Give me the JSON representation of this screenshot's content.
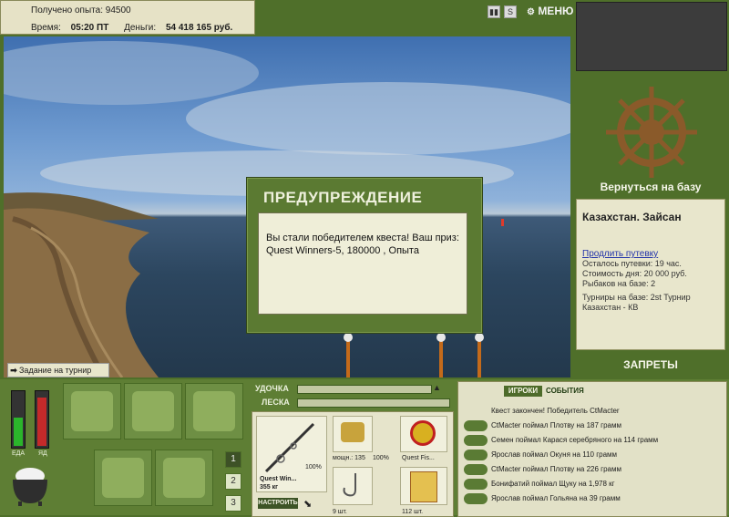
{
  "header": {
    "exp_label": "Получено опыта:",
    "exp_value": "94500",
    "time_label": "Время:",
    "time_value": "05:20 ПТ",
    "money_label": "Деньги:",
    "money_value": "54 418 165 руб.",
    "menu_label": "МЕНЮ"
  },
  "dialog": {
    "title": "ПРЕДУПРЕЖДЕНИЕ",
    "message": "Вы стали победителем квеста! Ваш приз: Quest Winners-5, 180000 , Опыта"
  },
  "quest_button": "Задание на турнир",
  "right_panel": {
    "return_base": "Вернуться на базу",
    "location": "Казахстан. Зайсан",
    "extend_link": "Продлить путевку",
    "info": [
      "Осталось путевки: 19 час.",
      "Стоимость дня: 20 000 руб.",
      "Рыбаков на базе: 2",
      "Турниры на базе: 2st Турнир Казахстан - КВ"
    ],
    "bans": "ЗАПРЕТЫ"
  },
  "meters": {
    "food_label": "ЕДА",
    "poison_label": "ЯД",
    "food_level": 0.55,
    "poison_level": 0.95
  },
  "inventory": {
    "pages": [
      "1",
      "2",
      "3"
    ]
  },
  "tackle": {
    "rod_label": "УДОЧКА",
    "line_label": "ЛЕСКА",
    "rod_name": "Quest Win...",
    "rod_weight": "355 кг",
    "rod_pct": "100%",
    "reel_caption": "мощн.: 135",
    "reel_pct": "100%",
    "line_name": "Quest Fis...",
    "hook_count": "9 шт.",
    "bait_count": "112 шт.",
    "setup_button": "НАСТРОИТЬ"
  },
  "chat": {
    "tab_players": "ИГРОКИ",
    "tab_events": "СОБЫТИЯ",
    "messages": [
      "Квест закончен! Победитель CtMacter",
      "CtMacter поймал Плотву на 187 грамм",
      "Семен поймал Карася серебряного на 114 грамм",
      "Ярослав поймал Окуня на 110 грамм",
      "CtMacter поймал Плотву на 226 грамм",
      "Бонифатий поймал Щуку на 1,978 кг",
      "Ярослав поймал Гольяна на 39 грамм"
    ]
  },
  "colors": {
    "frame_green": "#4f6f2a",
    "panel_beige": "#e8e6cc",
    "dialog_green": "#5b7a32"
  }
}
